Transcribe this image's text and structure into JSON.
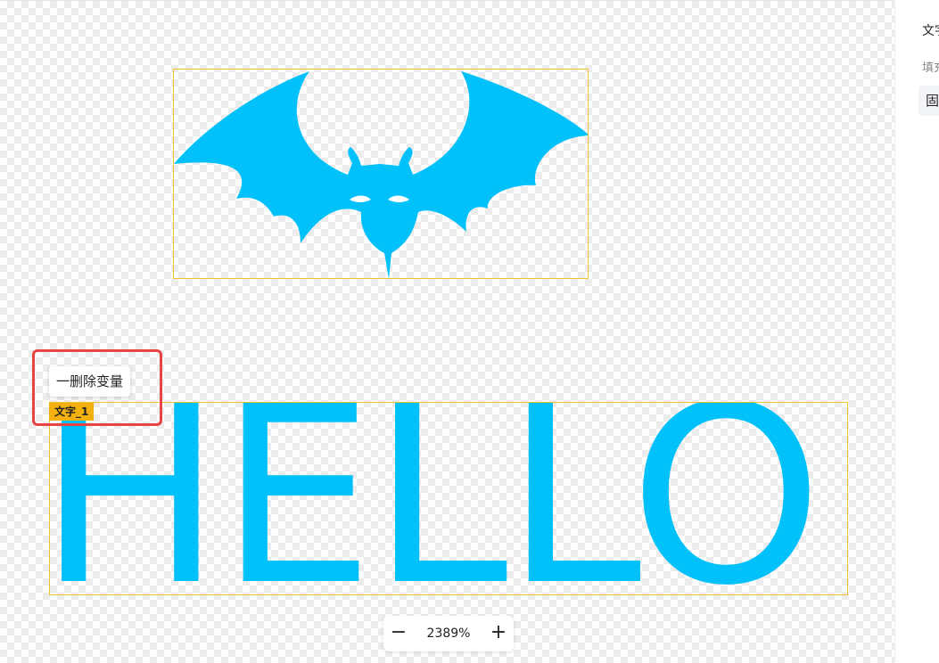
{
  "canvas": {
    "accent_color": "#00c1f9",
    "selection_color": "#f2c12e",
    "hello_text": "HELLO",
    "layer_tag": "文字_1",
    "delete_variable_label": "一删除变量",
    "highlight_color": "#e94444"
  },
  "right_panel": {
    "title": "文字",
    "fill_label": "填充",
    "fill_type": "固定"
  },
  "zoom": {
    "value": "2389%",
    "zoom_out_icon": "minus-icon",
    "zoom_in_icon": "plus-icon",
    "zoom_out_symbol": "−",
    "zoom_in_symbol": "+"
  }
}
